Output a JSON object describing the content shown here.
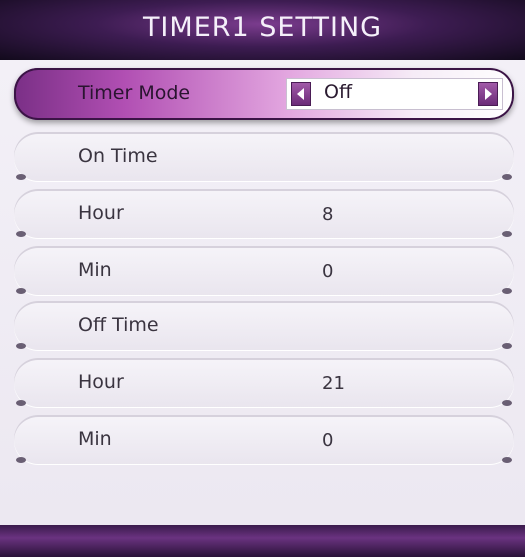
{
  "title": "TIMER1 SETTING",
  "timer_mode": {
    "label": "Timer Mode",
    "value": "Off",
    "left_icon": "left-arrow-icon",
    "right_icon": "right-arrow-icon"
  },
  "rows": [
    {
      "label": "On Time",
      "value": ""
    },
    {
      "label": "Hour",
      "value": "8"
    },
    {
      "label": "Min",
      "value": "0"
    },
    {
      "label": "Off Time",
      "value": ""
    },
    {
      "label": "Hour",
      "value": "21"
    },
    {
      "label": "Min",
      "value": "0"
    }
  ],
  "colors": {
    "accent": "#7a2f86",
    "header": "#3d1c52",
    "text": "#3a3440"
  }
}
